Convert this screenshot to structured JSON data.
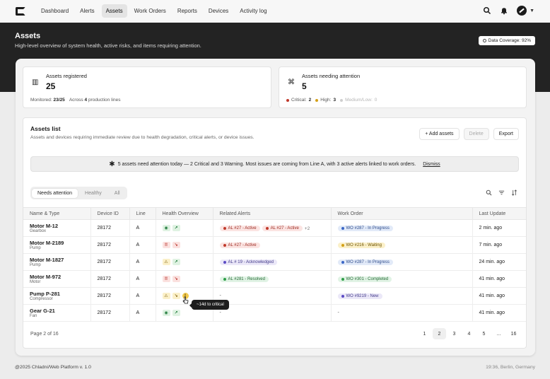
{
  "nav": {
    "items": [
      "Dashboard",
      "Alerts",
      "Assets",
      "Work Orders",
      "Reports",
      "Devices",
      "Activity log"
    ],
    "active_index": 2
  },
  "hero": {
    "title": "Assets",
    "subtitle": "High-level overview of system health, active risks, and items requiring attention.",
    "coverage": "Data Coverage: 92%"
  },
  "stats": {
    "registered": {
      "label": "Assets registered",
      "value": "25",
      "monitored_label": "Monitored:",
      "monitored_value": "23/25",
      "across_label": "Across",
      "lines_value": "4",
      "lines_label": "production lines"
    },
    "attention": {
      "label": "Assets needing attention",
      "value": "5",
      "critical_label": "Critical:",
      "critical_value": "2",
      "high_label": "High:",
      "high_value": "3",
      "low_label": "Medium/Low:",
      "low_value": "0"
    }
  },
  "list": {
    "title": "Assets list",
    "subtitle": "Assets and devices requiring immediate review due to health degradation, critical alerts, or device issues.",
    "add_label": "+ Add assets",
    "delete_label": "Delete",
    "export_label": "Export",
    "banner_text": "5 assets need attention today — 2 Critical and 3 Warning. Most issues are coming from Line A, with 3 active alerts linked to work orders.",
    "dismiss_label": "Dismiss",
    "tabs": [
      "Needs attention",
      "Healthy",
      "All"
    ],
    "columns": [
      "Name & Type",
      "Device ID",
      "Line",
      "Health Overview",
      "Related Alerts",
      "Work Order",
      "Last Update"
    ],
    "rows": [
      {
        "name": "Motor M-12",
        "type": "Gearbox",
        "device": "28172",
        "line": "A",
        "alerts": [
          {
            "text": "AL #27 - Active",
            "tone": "red"
          },
          {
            "text": "AL #27 - Active",
            "tone": "red"
          }
        ],
        "more": "+2",
        "wo": {
          "text": "WO #287 - In Progress",
          "tone": "blue"
        },
        "updated": "2 min. ago"
      },
      {
        "name": "Motor M-2189",
        "type": "Pump",
        "device": "28172",
        "line": "A",
        "alerts": [
          {
            "text": "AL #27 - Active",
            "tone": "red"
          }
        ],
        "more": "",
        "wo": {
          "text": "WO #216 - Waiting",
          "tone": "amber"
        },
        "updated": "7 min. ago"
      },
      {
        "name": "Motor M-1827",
        "type": "Pump",
        "device": "28172",
        "line": "A",
        "alerts": [
          {
            "text": "AL # 19 - Acknowledged",
            "tone": "purple"
          }
        ],
        "more": "",
        "wo": {
          "text": "WO #287 - In Progress",
          "tone": "blue"
        },
        "updated": "24 min. ago"
      },
      {
        "name": "Motor M-972",
        "type": "Motor",
        "device": "28172",
        "line": "A",
        "alerts": [
          {
            "text": "AL #281 - Resolved",
            "tone": "green"
          }
        ],
        "more": "",
        "wo": {
          "text": "WO #301 - Completed",
          "tone": "green"
        },
        "updated": "41 min. ago"
      },
      {
        "name": "Pump P-281",
        "type": "Compressor",
        "device": "28172",
        "line": "A",
        "alerts": [],
        "alert_dash": "-",
        "more": "",
        "wo": {
          "text": "WO #9219 - New",
          "tone": "purple"
        },
        "updated": "41 min. ago"
      },
      {
        "name": "Gear G-21",
        "type": "Fan",
        "device": "28172",
        "line": "A",
        "alerts": [],
        "alert_dash": "-",
        "more": "",
        "wo": null,
        "wo_dash": "-",
        "updated": "41 min. ago"
      }
    ],
    "tooltip": "~14d to critical",
    "page_label": "Page 2 of 16",
    "pages": [
      "1",
      "2",
      "3",
      "4",
      "5",
      "...",
      "16"
    ],
    "active_page": "2"
  },
  "footer": {
    "left": "@2025 Chladni/Web Platform v. 1.0",
    "right": "19:36, Berlin, Germany"
  },
  "colors": {
    "hero_bg": "#232323",
    "critical": "#c0392b",
    "high": "#d4a017"
  }
}
